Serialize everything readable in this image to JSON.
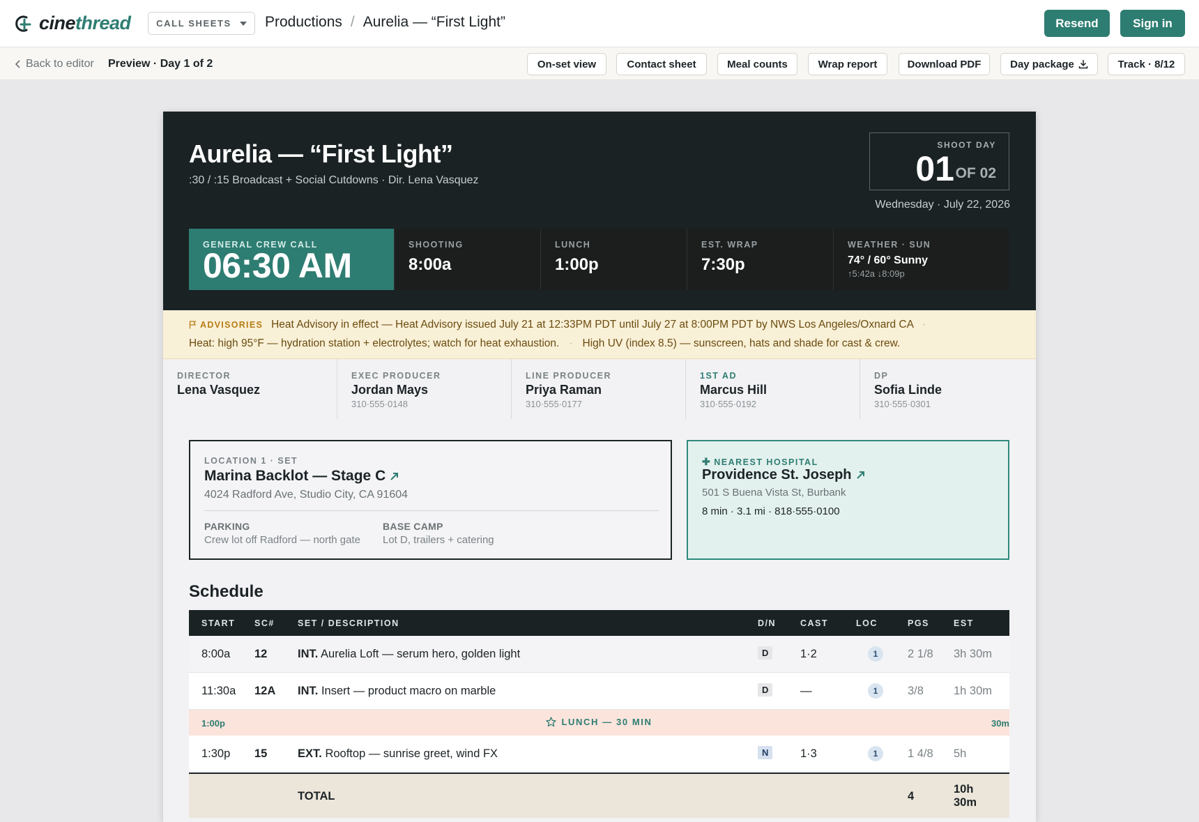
{
  "app": {
    "brand_prefix": "cine",
    "brand_suffix": "thread",
    "mode": "CALL SHEETS",
    "breadcrumb": [
      "Productions",
      "Aurelia — “First Light”"
    ],
    "resend_label": "Resend",
    "signin_label": "Sign in",
    "accent_color": "#2e7d72"
  },
  "subbar": {
    "back_label": "Back to editor",
    "preview_label": "Preview · Day 1 of 2",
    "actions": [
      "On-set view",
      "Contact sheet",
      "Meal counts",
      "Wrap report",
      "Download PDF",
      "Day package",
      "Track · 8/12"
    ]
  },
  "sheet": {
    "title": "Aurelia — “First Light”",
    "subtitle": ":30 / :15 Broadcast + Social Cutdowns  ·  Dir. Lena Vasquez",
    "shoot_day_label": "SHOOT DAY",
    "day_num": "01",
    "day_of": "OF 02",
    "date": "Wednesday · July 22, 2026",
    "times": {
      "call_label": "GENERAL CREW CALL",
      "call": "06:30 AM",
      "shooting_label": "SHOOTING",
      "shooting": "8:00a",
      "lunch_label": "LUNCH",
      "lunch": "1:00p",
      "wrap_label": "EST. WRAP",
      "wrap": "7:30p",
      "weather_label": "WEATHER · SUN",
      "weather": "74° / 60° Sunny",
      "sun": "↑5:42a ↓8:09p"
    },
    "advisories": {
      "label": "ADVISORIES",
      "items": [
        "Heat Advisory in effect — Heat Advisory issued July 21 at 12:33PM PDT until July 27 at 8:00PM PDT by NWS Los Angeles/Oxnard CA",
        "Heat: high 95°F — hydration station + electrolytes; watch for heat exhaustion.",
        "High UV (index 8.5) — sunscreen, hats and shade for cast & crew."
      ]
    },
    "contacts": [
      {
        "role": "DIRECTOR",
        "name": "Lena Vasquez",
        "phone": ""
      },
      {
        "role": "EXEC PRODUCER",
        "name": "Jordan Mays",
        "phone": "310·555·0148"
      },
      {
        "role": "LINE PRODUCER",
        "name": "Priya Raman",
        "phone": "310·555·0177"
      },
      {
        "role": "1ST AD",
        "name": "Marcus Hill",
        "phone": "310·555·0192"
      },
      {
        "role": "DP",
        "name": "Sofia Linde",
        "phone": "310·555·0301"
      }
    ],
    "location": {
      "label": "LOCATION 1 · SET",
      "name": "Marina Backlot — Stage C",
      "address": "4024 Radford Ave, Studio City, CA 91604",
      "parking_label": "PARKING",
      "parking": "Crew lot off Radford — north gate",
      "basecamp_label": "BASE CAMP",
      "basecamp": "Lot D, trailers + catering"
    },
    "hospital": {
      "label": "NEAREST HOSPITAL",
      "name": "Providence St. Joseph",
      "address": "501 S Buena Vista St, Burbank",
      "meta": "8 min · 3.1 mi · 818·555·0100"
    },
    "schedule": {
      "title": "Schedule",
      "headers": [
        "START",
        "SC#",
        "SET / DESCRIPTION",
        "D/N",
        "CAST",
        "LOC",
        "PGS",
        "EST"
      ],
      "rows": [
        {
          "start": "8:00a",
          "sc": "12",
          "ie": "INT.",
          "desc": "Aurelia Loft — serum hero, golden light",
          "dn": "D",
          "cast": "1·2",
          "loc": "1",
          "pgs": "2 1/8",
          "est": "3h 30m"
        },
        {
          "start": "11:30a",
          "sc": "12A",
          "ie": "INT.",
          "desc": "Insert — product macro on marble",
          "dn": "D",
          "cast": "—",
          "loc": "1",
          "pgs": "3/8",
          "est": "1h 30m"
        },
        {
          "start": "1:30p",
          "sc": "15",
          "ie": "EXT.",
          "desc": "Rooftop — sunrise greet, wind FX",
          "dn": "N",
          "cast": "1·3",
          "loc": "1",
          "pgs": "1 4/8",
          "est": "5h"
        }
      ],
      "lunch": {
        "time": "1:00p",
        "label": "LUNCH — 30 MIN",
        "dur": "30m"
      },
      "total": {
        "label": "TOTAL",
        "pgs": "4",
        "est_line1": "10h",
        "est_line2": "30m"
      }
    }
  }
}
